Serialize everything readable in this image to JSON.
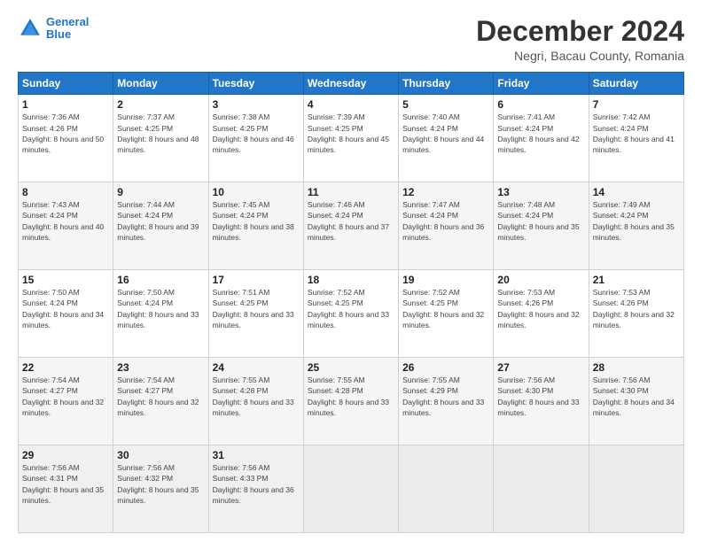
{
  "logo": {
    "line1": "General",
    "line2": "Blue"
  },
  "title": "December 2024",
  "subtitle": "Negri, Bacau County, Romania",
  "days_header": [
    "Sunday",
    "Monday",
    "Tuesday",
    "Wednesday",
    "Thursday",
    "Friday",
    "Saturday"
  ],
  "weeks": [
    [
      {
        "day": "1",
        "sunrise": "7:36 AM",
        "sunset": "4:26 PM",
        "daylight": "8 hours and 50 minutes."
      },
      {
        "day": "2",
        "sunrise": "7:37 AM",
        "sunset": "4:25 PM",
        "daylight": "8 hours and 48 minutes."
      },
      {
        "day": "3",
        "sunrise": "7:38 AM",
        "sunset": "4:25 PM",
        "daylight": "8 hours and 46 minutes."
      },
      {
        "day": "4",
        "sunrise": "7:39 AM",
        "sunset": "4:25 PM",
        "daylight": "8 hours and 45 minutes."
      },
      {
        "day": "5",
        "sunrise": "7:40 AM",
        "sunset": "4:24 PM",
        "daylight": "8 hours and 44 minutes."
      },
      {
        "day": "6",
        "sunrise": "7:41 AM",
        "sunset": "4:24 PM",
        "daylight": "8 hours and 42 minutes."
      },
      {
        "day": "7",
        "sunrise": "7:42 AM",
        "sunset": "4:24 PM",
        "daylight": "8 hours and 41 minutes."
      }
    ],
    [
      {
        "day": "8",
        "sunrise": "7:43 AM",
        "sunset": "4:24 PM",
        "daylight": "8 hours and 40 minutes."
      },
      {
        "day": "9",
        "sunrise": "7:44 AM",
        "sunset": "4:24 PM",
        "daylight": "8 hours and 39 minutes."
      },
      {
        "day": "10",
        "sunrise": "7:45 AM",
        "sunset": "4:24 PM",
        "daylight": "8 hours and 38 minutes."
      },
      {
        "day": "11",
        "sunrise": "7:46 AM",
        "sunset": "4:24 PM",
        "daylight": "8 hours and 37 minutes."
      },
      {
        "day": "12",
        "sunrise": "7:47 AM",
        "sunset": "4:24 PM",
        "daylight": "8 hours and 36 minutes."
      },
      {
        "day": "13",
        "sunrise": "7:48 AM",
        "sunset": "4:24 PM",
        "daylight": "8 hours and 35 minutes."
      },
      {
        "day": "14",
        "sunrise": "7:49 AM",
        "sunset": "4:24 PM",
        "daylight": "8 hours and 35 minutes."
      }
    ],
    [
      {
        "day": "15",
        "sunrise": "7:50 AM",
        "sunset": "4:24 PM",
        "daylight": "8 hours and 34 minutes."
      },
      {
        "day": "16",
        "sunrise": "7:50 AM",
        "sunset": "4:24 PM",
        "daylight": "8 hours and 33 minutes."
      },
      {
        "day": "17",
        "sunrise": "7:51 AM",
        "sunset": "4:25 PM",
        "daylight": "8 hours and 33 minutes."
      },
      {
        "day": "18",
        "sunrise": "7:52 AM",
        "sunset": "4:25 PM",
        "daylight": "8 hours and 33 minutes."
      },
      {
        "day": "19",
        "sunrise": "7:52 AM",
        "sunset": "4:25 PM",
        "daylight": "8 hours and 32 minutes."
      },
      {
        "day": "20",
        "sunrise": "7:53 AM",
        "sunset": "4:26 PM",
        "daylight": "8 hours and 32 minutes."
      },
      {
        "day": "21",
        "sunrise": "7:53 AM",
        "sunset": "4:26 PM",
        "daylight": "8 hours and 32 minutes."
      }
    ],
    [
      {
        "day": "22",
        "sunrise": "7:54 AM",
        "sunset": "4:27 PM",
        "daylight": "8 hours and 32 minutes."
      },
      {
        "day": "23",
        "sunrise": "7:54 AM",
        "sunset": "4:27 PM",
        "daylight": "8 hours and 32 minutes."
      },
      {
        "day": "24",
        "sunrise": "7:55 AM",
        "sunset": "4:28 PM",
        "daylight": "8 hours and 33 minutes."
      },
      {
        "day": "25",
        "sunrise": "7:55 AM",
        "sunset": "4:28 PM",
        "daylight": "8 hours and 33 minutes."
      },
      {
        "day": "26",
        "sunrise": "7:55 AM",
        "sunset": "4:29 PM",
        "daylight": "8 hours and 33 minutes."
      },
      {
        "day": "27",
        "sunrise": "7:56 AM",
        "sunset": "4:30 PM",
        "daylight": "8 hours and 33 minutes."
      },
      {
        "day": "28",
        "sunrise": "7:56 AM",
        "sunset": "4:30 PM",
        "daylight": "8 hours and 34 minutes."
      }
    ],
    [
      {
        "day": "29",
        "sunrise": "7:56 AM",
        "sunset": "4:31 PM",
        "daylight": "8 hours and 35 minutes."
      },
      {
        "day": "30",
        "sunrise": "7:56 AM",
        "sunset": "4:32 PM",
        "daylight": "8 hours and 35 minutes."
      },
      {
        "day": "31",
        "sunrise": "7:56 AM",
        "sunset": "4:33 PM",
        "daylight": "8 hours and 36 minutes."
      },
      null,
      null,
      null,
      null
    ]
  ]
}
